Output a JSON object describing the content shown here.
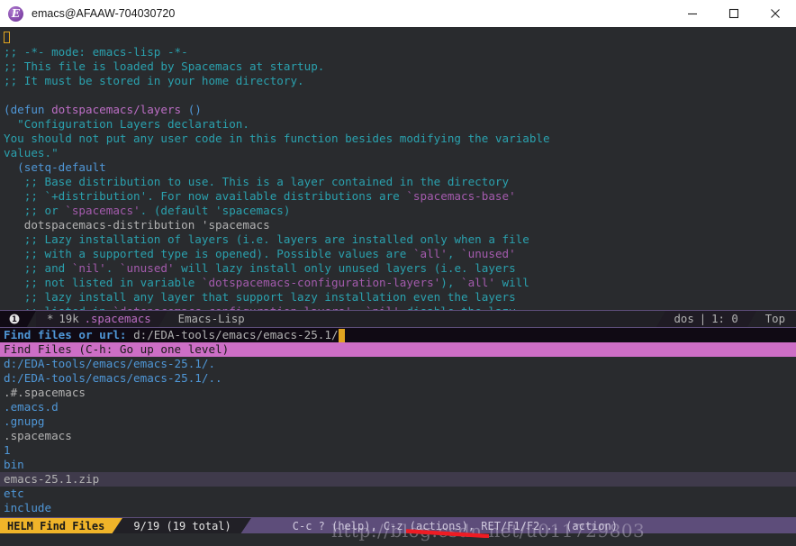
{
  "window": {
    "title": "emacs@AFAAW-704030720",
    "icon": "emacs-icon",
    "icon_glyph": "E",
    "controls": {
      "minimize": "minimize-icon",
      "maximize": "maximize-icon",
      "close": "close-icon"
    }
  },
  "buffer": {
    "lines": [
      {
        "id": "l1",
        "segments": [
          {
            "cls": "cursorbox",
            "text": ""
          }
        ]
      },
      {
        "id": "l2",
        "segments": [
          {
            "cls": "cmt",
            "text": ";; -*- mode: emacs-lisp -*-"
          }
        ]
      },
      {
        "id": "l3",
        "segments": [
          {
            "cls": "cmt",
            "text": ";; This file is loaded by Spacemacs at startup."
          }
        ]
      },
      {
        "id": "l4",
        "segments": [
          {
            "cls": "cmt",
            "text": ";; It must be stored in your home directory."
          }
        ]
      },
      {
        "id": "l5",
        "segments": [
          {
            "cls": "txt",
            "text": ""
          }
        ]
      },
      {
        "id": "l6",
        "segments": [
          {
            "cls": "kw",
            "text": "(defun "
          },
          {
            "cls": "fn",
            "text": "dotspacemacs/layers"
          },
          {
            "cls": "kw",
            "text": " ()"
          }
        ]
      },
      {
        "id": "l7",
        "segments": [
          {
            "cls": "doc",
            "text": "  \"Configuration Layers declaration."
          }
        ]
      },
      {
        "id": "l8",
        "segments": [
          {
            "cls": "doc",
            "text": "You should not put any user code in this function besides modifying the variable"
          }
        ]
      },
      {
        "id": "l9",
        "segments": [
          {
            "cls": "doc",
            "text": "values.\""
          }
        ]
      },
      {
        "id": "l10",
        "segments": [
          {
            "cls": "kw",
            "text": "  (setq-default"
          }
        ]
      },
      {
        "id": "l11",
        "segments": [
          {
            "cls": "cmt",
            "text": "   ;; Base distribution to use. This is a layer contained in the directory"
          }
        ]
      },
      {
        "id": "l12",
        "segments": [
          {
            "cls": "cmt",
            "text": "   ;; `+distribution'. For now available distributions are "
          },
          {
            "cls": "lit",
            "text": "`spacemacs-base'"
          }
        ]
      },
      {
        "id": "l13",
        "segments": [
          {
            "cls": "cmt",
            "text": "   ;; or "
          },
          {
            "cls": "lit",
            "text": "`spacemacs'"
          },
          {
            "cls": "cmt",
            "text": ". (default 'spacemacs)"
          }
        ]
      },
      {
        "id": "l14",
        "segments": [
          {
            "cls": "txt",
            "text": "   dotspacemacs-distribution 'spacemacs"
          }
        ]
      },
      {
        "id": "l15",
        "segments": [
          {
            "cls": "cmt",
            "text": "   ;; Lazy installation of layers (i.e. layers are installed only when a file"
          }
        ]
      },
      {
        "id": "l16",
        "segments": [
          {
            "cls": "cmt",
            "text": "   ;; with a supported type is opened). Possible values are "
          },
          {
            "cls": "lit",
            "text": "`all'"
          },
          {
            "cls": "cmt",
            "text": ", "
          },
          {
            "cls": "lit",
            "text": "`unused'"
          }
        ]
      },
      {
        "id": "l17",
        "segments": [
          {
            "cls": "cmt",
            "text": "   ;; and "
          },
          {
            "cls": "lit",
            "text": "`nil'"
          },
          {
            "cls": "cmt",
            "text": ". "
          },
          {
            "cls": "lit",
            "text": "`unused'"
          },
          {
            "cls": "cmt",
            "text": " will lazy install only unused layers (i.e. layers"
          }
        ]
      },
      {
        "id": "l18",
        "segments": [
          {
            "cls": "cmt",
            "text": "   ;; not listed in variable "
          },
          {
            "cls": "lit",
            "text": "`dotspacemacs-configuration-layers'"
          },
          {
            "cls": "cmt",
            "text": "), "
          },
          {
            "cls": "lit",
            "text": "`all'"
          },
          {
            "cls": "cmt",
            "text": " will"
          }
        ]
      },
      {
        "id": "l19",
        "segments": [
          {
            "cls": "cmt",
            "text": "   ;; lazy install any layer that support lazy installation even the layers"
          }
        ]
      },
      {
        "id": "l20",
        "segments": [
          {
            "cls": "cmt",
            "text": "   ;; listed in "
          },
          {
            "cls": "lit",
            "text": "`dotspacemacs-configuration-layers'"
          },
          {
            "cls": "cmt",
            "text": ". "
          },
          {
            "cls": "lit",
            "text": "`nil'"
          },
          {
            "cls": "cmt",
            "text": " disable the lazy"
          }
        ]
      }
    ]
  },
  "modeline": {
    "window_number": "1",
    "modified_indicator": "*",
    "size": "19k",
    "buffer_name": ".spacemacs",
    "major_mode": "Emacs-Lisp",
    "encoding": "dos",
    "separator": "|",
    "position": "1: 0",
    "scroll": "Top"
  },
  "helm": {
    "prompt_label": "Find files or url: ",
    "prompt_value": "d:/EDA-tools/emacs/emacs-25.1/",
    "source_header": "Find Files (C-h: Go up one level)",
    "items": [
      {
        "label": "d:/EDA-tools/emacs/emacs-25.1/.",
        "kind": "dir",
        "selected": false
      },
      {
        "label": "d:/EDA-tools/emacs/emacs-25.1/..",
        "kind": "dir",
        "selected": false
      },
      {
        "label": ".#.spacemacs",
        "kind": "file",
        "selected": false
      },
      {
        "label": ".emacs.d",
        "kind": "dir",
        "selected": false
      },
      {
        "label": ".gnupg",
        "kind": "dir",
        "selected": false
      },
      {
        "label": ".spacemacs",
        "kind": "file",
        "selected": false
      },
      {
        "label": "1",
        "kind": "dir",
        "selected": false
      },
      {
        "label": "bin",
        "kind": "dir",
        "selected": false
      },
      {
        "label": "emacs-25.1.zip",
        "kind": "file",
        "selected": true
      },
      {
        "label": "etc",
        "kind": "dir",
        "selected": false
      },
      {
        "label": "include",
        "kind": "dir",
        "selected": false
      }
    ],
    "modeline": {
      "source_name": "HELM Find Files",
      "count": "9/19 (19 total)",
      "help": "C-c ? (help), C-z (actions), RET/F1/F2... (action)"
    }
  },
  "overlay": {
    "watermark": "http://blog.csdn.net/u011729803",
    "annotation": "red-underline"
  },
  "colors": {
    "background": "#292b2e",
    "modeline_bg": "#212026",
    "modeline_border": "#5d4d7a",
    "helm_source_bg": "#cd6ec6",
    "helm_selected_bg": "#3f3a4b",
    "helm_name_bg": "#f0b429",
    "helm_modeline_bg": "#5d4d7a",
    "cursor": "#e0a420",
    "comment": "#2aa1ae",
    "keyword": "#4f97d7",
    "function": "#bc6ec5",
    "literal": "#a45bad",
    "text": "#b2b2b2",
    "annotation_red": "#ee1c24"
  }
}
